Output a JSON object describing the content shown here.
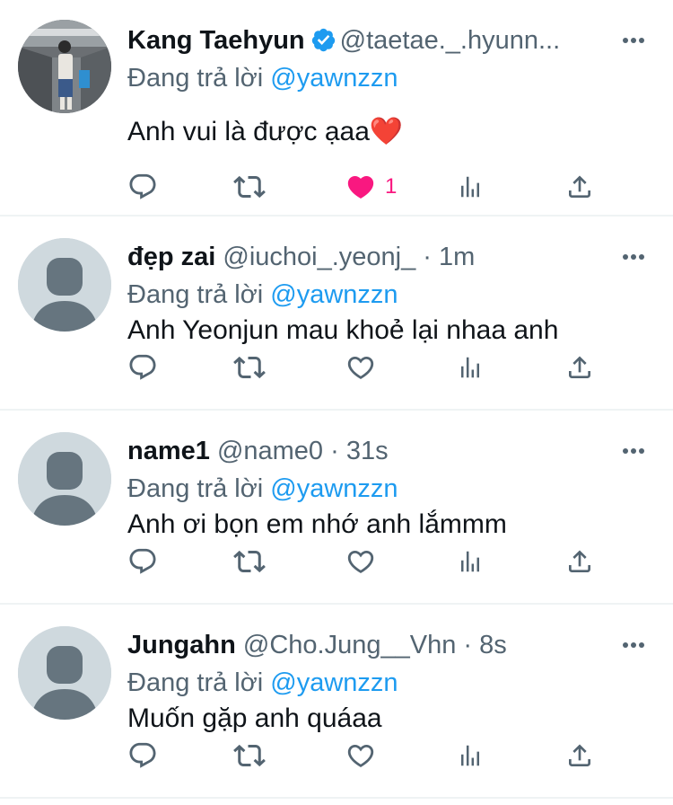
{
  "colors": {
    "link": "#1d9bf0",
    "like": "#f91880",
    "muted": "#536471",
    "text": "#0f1419"
  },
  "reply_prefix": "Đang trả lời",
  "tweets": [
    {
      "name": "Kang Taehyun",
      "verified": true,
      "handle": "@taetae._.hyunn...",
      "time": "",
      "mention": "@yawnzzn",
      "text": "Anh vui là được ạaa❤️",
      "liked": true,
      "like_count": "1",
      "avatar": "photo"
    },
    {
      "name": "đẹp zai",
      "verified": false,
      "handle": "@iuchoi_.yeonj_",
      "time": "1m",
      "mention": "@yawnzzn",
      "text": "Anh Yeonjun mau khoẻ lại nhaa anh",
      "liked": false,
      "like_count": "",
      "avatar": "default"
    },
    {
      "name": "name1",
      "verified": false,
      "handle": "@name0",
      "time": "31s",
      "mention": "@yawnzzn",
      "text": "Anh ơi bọn em nhớ anh lắmmm",
      "liked": false,
      "like_count": "",
      "avatar": "default"
    },
    {
      "name": "Jungahn",
      "verified": false,
      "handle": "@Cho.Jung__Vhn",
      "time": "8s",
      "mention": "@yawnzzn",
      "text": "Muốn gặp anh quáaa",
      "liked": false,
      "like_count": "",
      "avatar": "default"
    }
  ]
}
